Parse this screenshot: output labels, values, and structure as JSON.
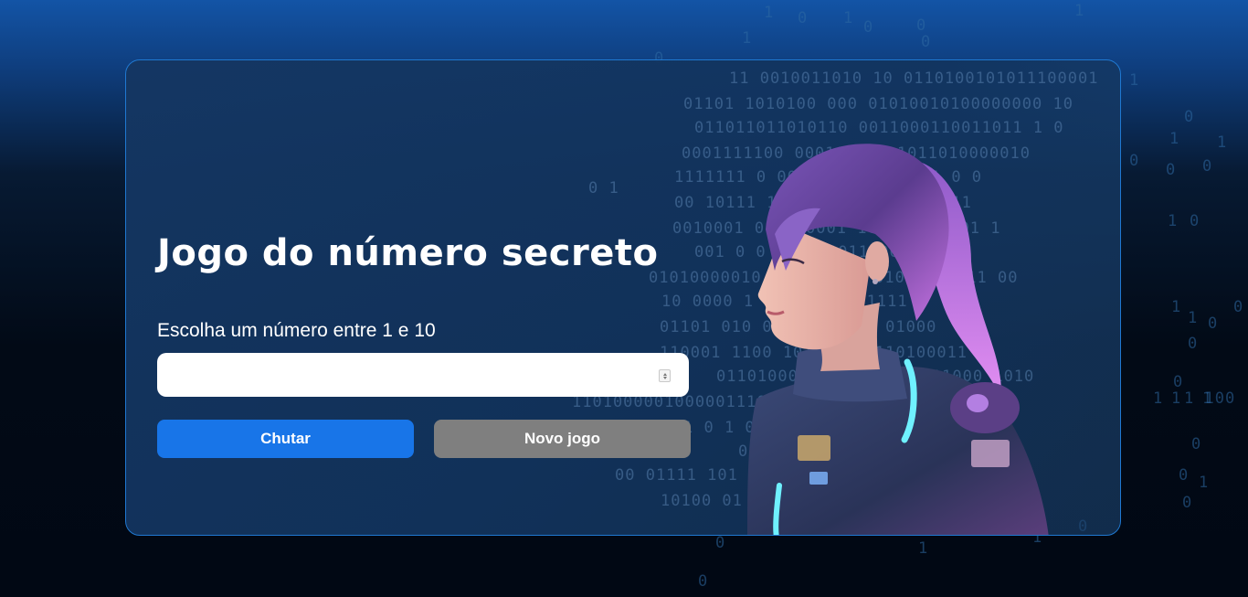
{
  "game": {
    "title": "Jogo do número secreto",
    "instruction": "Escolha um número entre 1 e 10",
    "input": {
      "value": "",
      "placeholder": "",
      "min": "1",
      "max": "10"
    },
    "guess_button_label": "Chutar",
    "new_game_button_label": "Novo jogo"
  },
  "colors": {
    "accent": "#1875E8",
    "secondary_button": "#7f7f7f",
    "panel_border": "#1f78d1",
    "background_top": "#1354A6",
    "background_bottom": "#010814"
  },
  "background_binary": {
    "outside": [
      "1",
      "0",
      "1",
      "0",
      "0",
      "1",
      "0",
      "1",
      "0",
      "1",
      "0",
      "1",
      "1",
      "0",
      "0",
      "0",
      "1",
      "0",
      "1",
      "1",
      "0",
      "0",
      "0",
      "0",
      "1",
      "1",
      "1",
      "1 100",
      "0",
      "0",
      "0",
      "1",
      "1",
      "0",
      "0",
      "1",
      "0"
    ],
    "inside": [
      "11 0010011010 10 0110100101011100001",
      "01101 1010100 000 01010010100000000 10",
      "011011011010110 0011000110011011 1 0",
      "0001111100 000101111 1011010000010",
      "1111111 0 0010001100000011 0 0",
      "00 10111 1001111 10011 001011",
      "0010001 011 10001 1000 1000 01 1",
      "001 0 0 011 01011000101 101",
      "01010000010 0101010 0 01010100011 00",
      "10 0000 1 0 10111 0 1111",
      "01101 010 0101 111111 01000",
      "110001 1100 1011 1 00110100011",
      "011010001 0 01000 00111000 1010",
      "110100000100000111001 11 00011 1 1",
      "1 0 1 0 10100011 0",
      "0 1 0 0 0 0",
      "00 01111 101 11 0 1 11011",
      "10100 01 0 10010 01100 0",
      "0 1"
    ]
  }
}
